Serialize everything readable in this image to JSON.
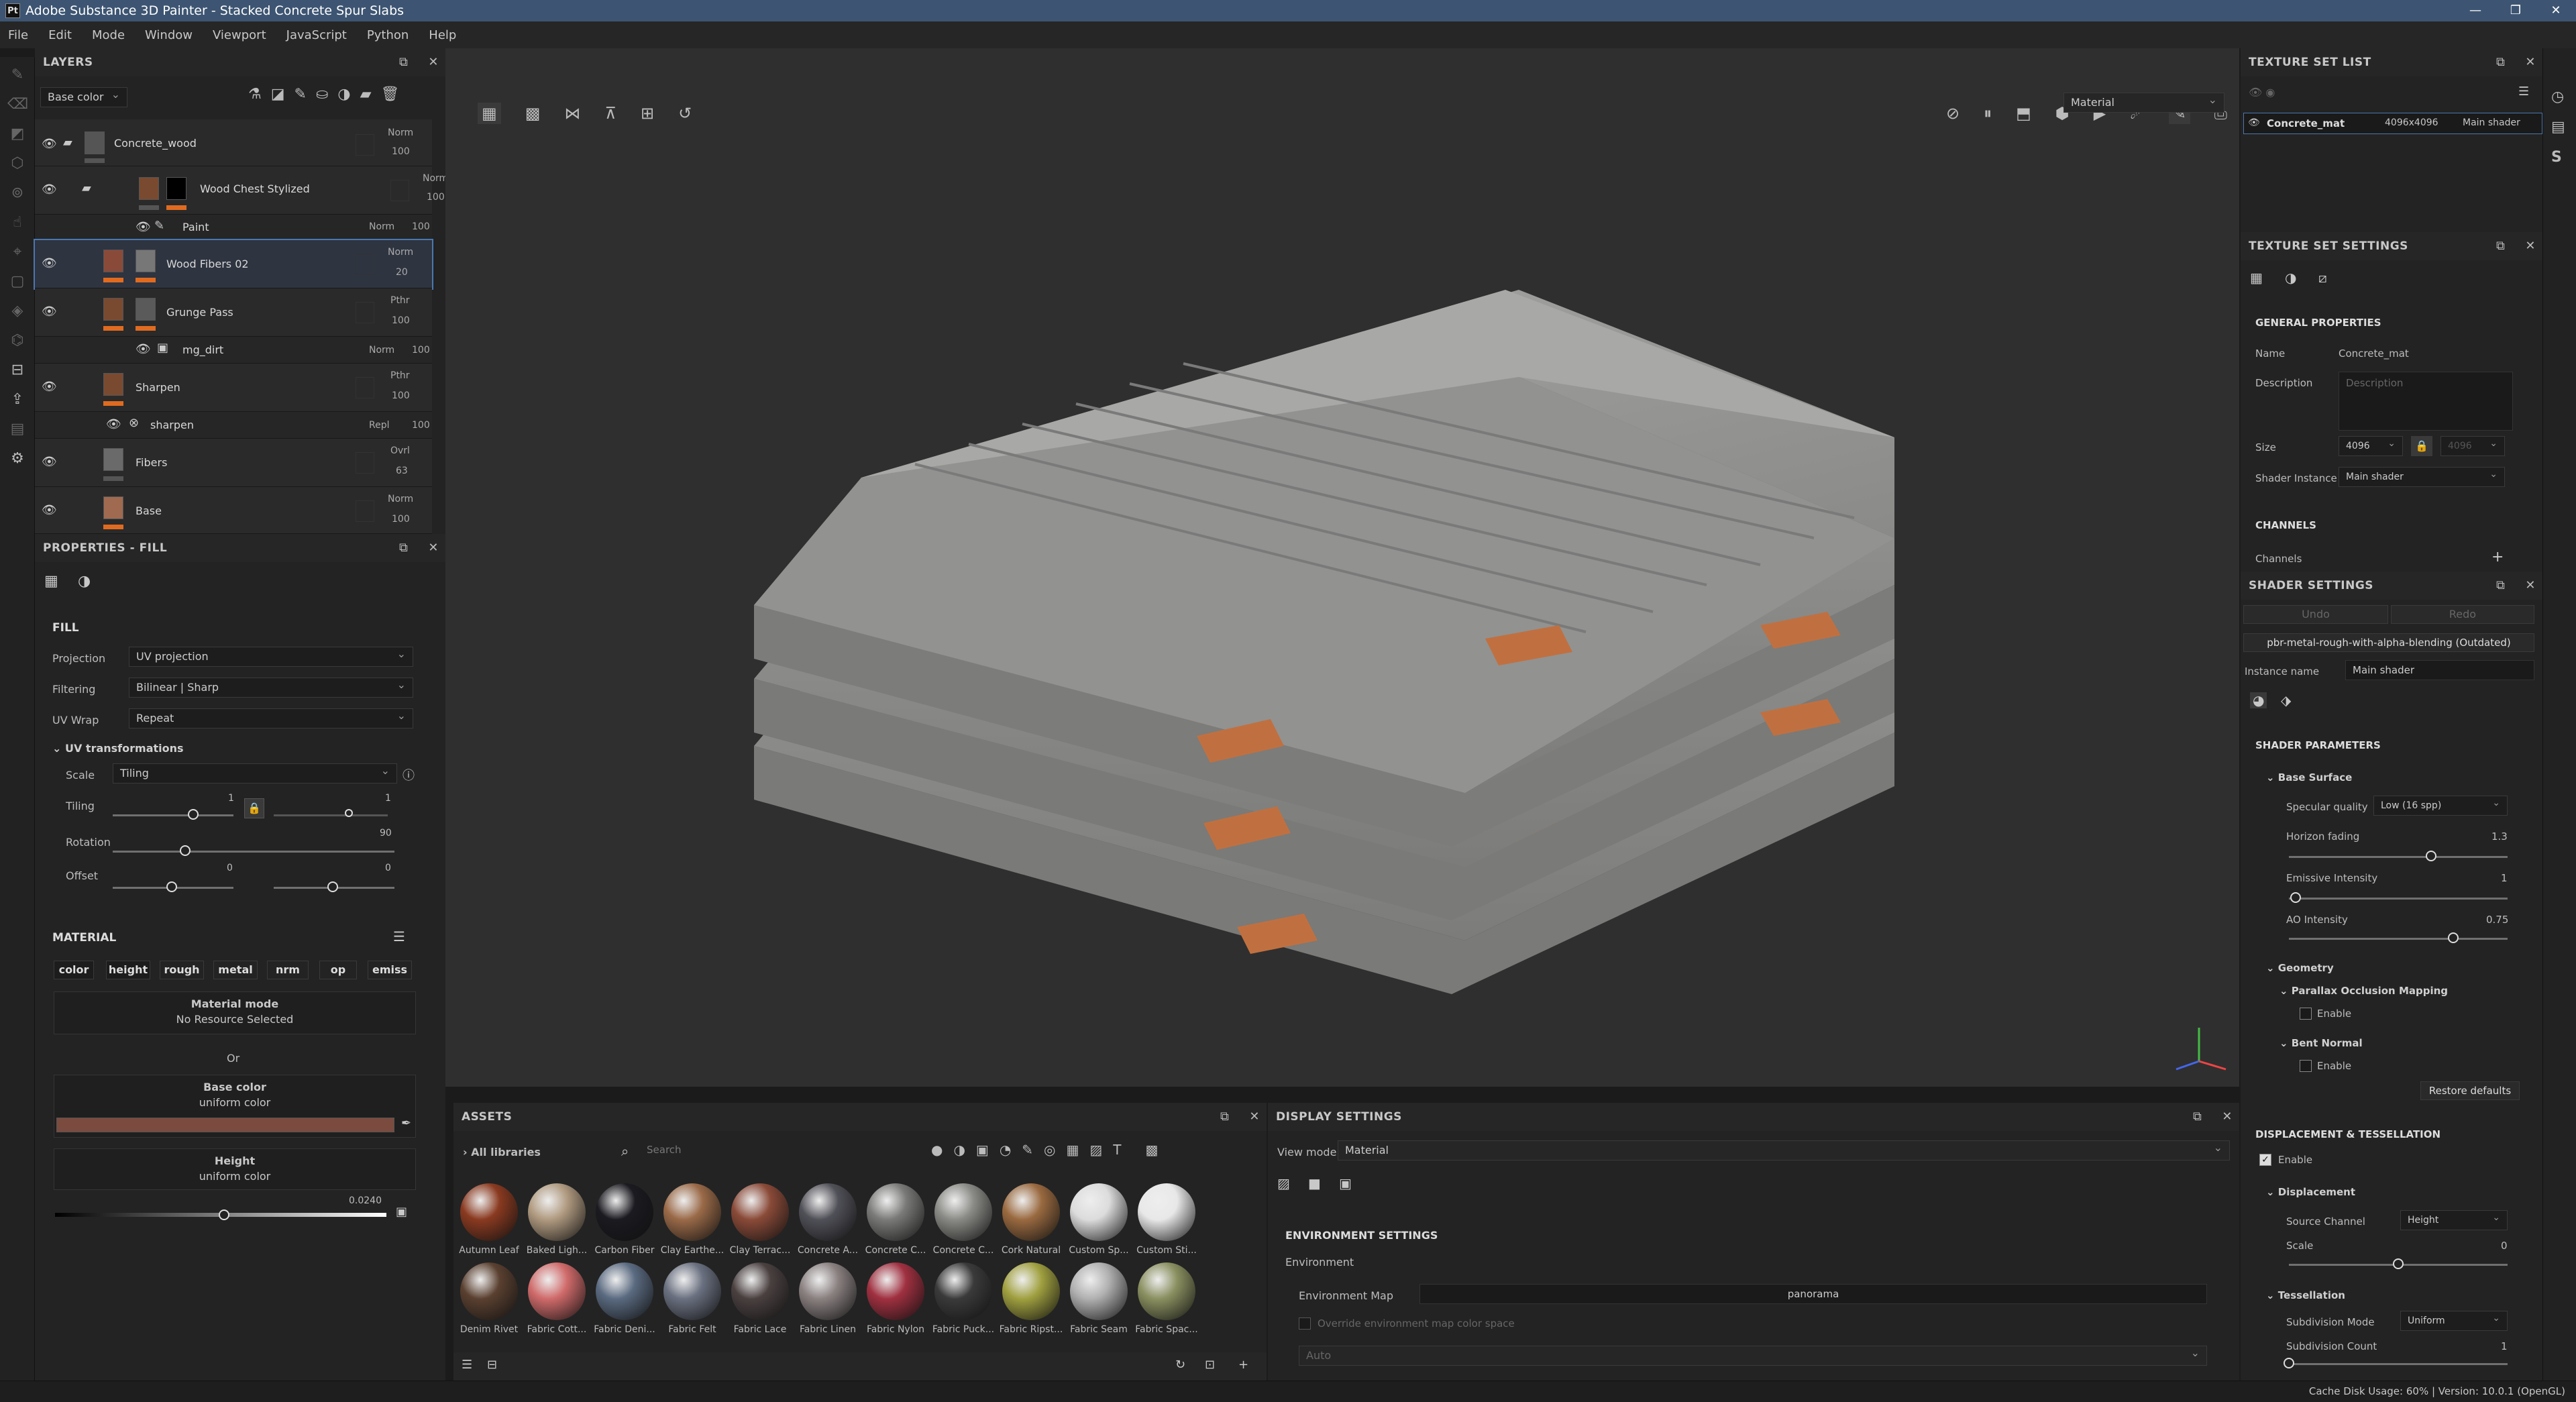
{
  "window": {
    "title": "Adobe Substance 3D Painter - Stacked Concrete Spur Slabs",
    "icon_label": "Pt"
  },
  "menu": [
    "File",
    "Edit",
    "Mode",
    "Window",
    "Viewport",
    "JavaScript",
    "Python",
    "Help"
  ],
  "layers": {
    "title": "LAYERS",
    "channel_select": "Base color",
    "items": [
      {
        "name": "Concrete_wood",
        "blend": "Norm",
        "opacity": "100",
        "kind": "folder"
      },
      {
        "name": "Wood Chest Stylized",
        "blend": "Norm",
        "opacity": "100",
        "kind": "folder-fill"
      },
      {
        "name": "Paint",
        "blend": "Norm",
        "opacity": "100",
        "kind": "sub"
      },
      {
        "name": "Wood Fibers 02",
        "blend": "Norm",
        "opacity": "20",
        "kind": "fill",
        "selected": true
      },
      {
        "name": "Grunge Pass",
        "blend": "Pthr",
        "opacity": "100",
        "kind": "fill"
      },
      {
        "name": "mg_dirt",
        "blend": "Norm",
        "opacity": "100",
        "kind": "sub"
      },
      {
        "name": "Sharpen",
        "blend": "Pthr",
        "opacity": "100",
        "kind": "fill"
      },
      {
        "name": "sharpen",
        "blend": "Repl",
        "opacity": "100",
        "kind": "sub"
      },
      {
        "name": "Fibers",
        "blend": "Ovrl",
        "opacity": "63",
        "kind": "fill"
      },
      {
        "name": "Base",
        "blend": "Norm",
        "opacity": "100",
        "kind": "fill"
      }
    ]
  },
  "properties": {
    "title": "PROPERTIES - FILL",
    "fill_header": "FILL",
    "projection_label": "Projection",
    "projection": "UV projection",
    "filtering_label": "Filtering",
    "filtering": "Bilinear | Sharp",
    "uvwrap_label": "UV Wrap",
    "uvwrap": "Repeat",
    "uvt_header": "UV transformations",
    "scale_label": "Scale",
    "scale": "Tiling",
    "tiling_label": "Tiling",
    "tiling_val": "1",
    "tiling_val2": "1",
    "rotation_label": "Rotation",
    "rotation_val": "90",
    "offset_label": "Offset",
    "offset_val": "0",
    "offset_val2": "0",
    "material_header": "MATERIAL",
    "chips": [
      "color",
      "height",
      "rough",
      "metal",
      "nrm",
      "op",
      "emiss"
    ],
    "material_mode_title": "Material mode",
    "material_mode_sub": "No Resource Selected",
    "or": "Or",
    "base_color_title": "Base color",
    "base_color_sub": "uniform color",
    "base_color_hex": "#7a4b3e",
    "height_title": "Height",
    "height_sub": "uniform color",
    "height_val": "0.0240",
    "height_level": 0.51
  },
  "viewport": {
    "mode": "Material"
  },
  "assets": {
    "title": "ASSETS",
    "library": "All libraries",
    "search_placeholder": "Search",
    "row1": [
      {
        "name": "Autumn Leaf",
        "color": "#8a3a20"
      },
      {
        "name": "Baked Ligh...",
        "color": "#b09a80"
      },
      {
        "name": "Carbon Fiber",
        "color": "#1a1a20"
      },
      {
        "name": "Clay Earthe...",
        "color": "#9a6a48"
      },
      {
        "name": "Clay Terrac...",
        "color": "#8a4a38"
      },
      {
        "name": "Concrete A...",
        "color": "#505058"
      },
      {
        "name": "Concrete C...",
        "color": "#7a7a78"
      },
      {
        "name": "Concrete C...",
        "color": "#8a8a86"
      },
      {
        "name": "Cork Natural",
        "color": "#9a6a40"
      },
      {
        "name": "Custom Sp...",
        "color": "#dcdcdc"
      },
      {
        "name": "Custom Sti...",
        "color": "#e8e8e8"
      }
    ],
    "row2": [
      {
        "name": "Denim Rivet",
        "color": "#5a4030"
      },
      {
        "name": "Fabric Cott...",
        "color": "#d06a6a"
      },
      {
        "name": "Fabric Deni...",
        "color": "#5a6a80"
      },
      {
        "name": "Fabric Felt",
        "color": "#6a7080"
      },
      {
        "name": "Fabric Lace",
        "color": "#4a4040"
      },
      {
        "name": "Fabric Linen",
        "color": "#8a8080"
      },
      {
        "name": "Fabric Nylon",
        "color": "#a03040"
      },
      {
        "name": "Fabric Puck...",
        "color": "#3a3a3a"
      },
      {
        "name": "Fabric Ripst...",
        "color": "#a0a040"
      },
      {
        "name": "Fabric Seam",
        "color": "#b0b0b0"
      },
      {
        "name": "Fabric Spac...",
        "color": "#8a9060"
      }
    ]
  },
  "display": {
    "title": "DISPLAY SETTINGS",
    "view_mode_label": "View mode",
    "view_mode": "Material",
    "env_header": "ENVIRONMENT SETTINGS",
    "env_label": "Environment",
    "env_map_label": "Environment Map",
    "env_map": "panorama",
    "override_label": "Override environment map color space",
    "auto": "Auto"
  },
  "texture_set_list": {
    "title": "TEXTURE SET LIST",
    "name": "Concrete_mat",
    "size": "4096x4096",
    "shader": "Main shader"
  },
  "texture_set_settings": {
    "title": "TEXTURE SET SETTINGS",
    "general": "GENERAL PROPERTIES",
    "name_label": "Name",
    "name": "Concrete_mat",
    "desc_label": "Description",
    "desc_placeholder": "Description",
    "size_label": "Size",
    "size": "4096",
    "size2": "4096",
    "shader_inst_label": "Shader Instance",
    "shader_inst": "Main shader",
    "channels_header": "CHANNELS",
    "channels_label": "Channels"
  },
  "shader_settings": {
    "title": "SHADER SETTINGS",
    "undo": "Undo",
    "redo": "Redo",
    "shader_name": "pbr-metal-rough-with-alpha-blending (Outdated)",
    "instance_label": "Instance name",
    "instance": "Main shader",
    "params_header": "SHADER PARAMETERS",
    "base_surface": "Base Surface",
    "spec_label": "Specular quality",
    "spec": "Low (16 spp)",
    "horizon_label": "Horizon fading",
    "horizon": "1.3",
    "horizon_level": 0.65,
    "emissive_label": "Emissive Intensity",
    "emissive": "1",
    "emissive_level": 0.03,
    "ao_label": "AO Intensity",
    "ao": "0.75",
    "ao_level": 0.75,
    "geometry": "Geometry",
    "pom": "Parallax Occlusion Mapping",
    "enable": "Enable",
    "bent": "Bent Normal",
    "restore": "Restore defaults",
    "disp_header": "DISPLACEMENT & TESSELLATION",
    "displacement": "Displacement",
    "source_label": "Source Channel",
    "source": "Height",
    "scale_label": "Scale",
    "scale": "0",
    "scale_level": 0.5,
    "tess": "Tessellation",
    "subdiv_mode_label": "Subdivision Mode",
    "subdiv_mode": "Uniform",
    "subdiv_count_label": "Subdivision Count",
    "subdiv_count": "1"
  },
  "status": "Cache Disk Usage:   60%  |  Version: 10.0.1 (OpenGL)"
}
